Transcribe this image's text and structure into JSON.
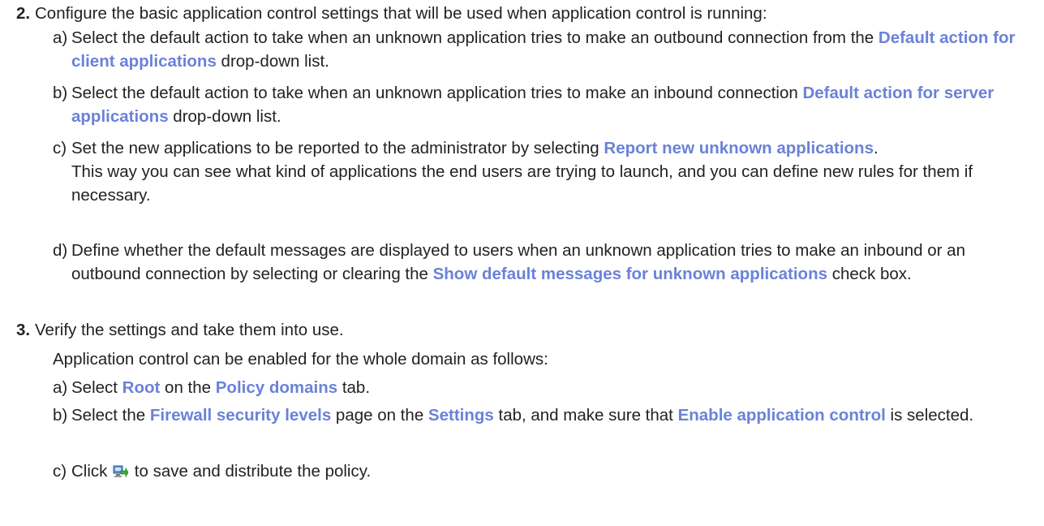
{
  "step2": {
    "number": "2.",
    "text": "Configure the basic application control settings that will be used when application control is running:",
    "a": {
      "letter": "a)",
      "t1": "Select the default action to take when an unknown application tries to make an outbound connection from the ",
      "ui1": "Default action for client applications",
      "t2": " drop-down list."
    },
    "b": {
      "letter": "b)",
      "t1": "Select the default action to take when an unknown application tries to make an inbound connection ",
      "ui1": "Default action for server applications",
      "t2": " drop-down list."
    },
    "c": {
      "letter": "c)",
      "t1": "Set the new applications to be reported to the administrator by selecting ",
      "ui1": "Report new unknown applications",
      "t2": ".",
      "note": "This way you can see what kind of applications the end users are trying to launch, and you can define new rules for them if necessary."
    },
    "d": {
      "letter": "d)",
      "t1": "Define whether the default messages are displayed to users when an unknown application tries to make an inbound or an outbound connection by selecting or clearing the ",
      "ui1": "Show default messages for unknown applications",
      "t2": " check box."
    }
  },
  "step3": {
    "number": "3.",
    "text": "Verify the settings and take them into use.",
    "intro": "Application control can be enabled for the whole domain as follows:",
    "a": {
      "letter": "a)",
      "t1": "Select ",
      "ui1": "Root",
      "t2": " on the ",
      "ui2": "Policy domains",
      "t3": " tab."
    },
    "b": {
      "letter": "b)",
      "t1": "Select the ",
      "ui1": "Firewall security levels",
      "t2": " page on the ",
      "ui2": "Settings",
      "t3": " tab, and make sure that ",
      "ui3": "Enable application control",
      "t4": " is selected."
    },
    "c": {
      "letter": "c)",
      "t1": "Click ",
      "icon": "save-and-distribute-icon",
      "t2": " to save and distribute the policy."
    }
  },
  "colors": {
    "ui_element": "#6a82d8",
    "text": "#222222"
  }
}
